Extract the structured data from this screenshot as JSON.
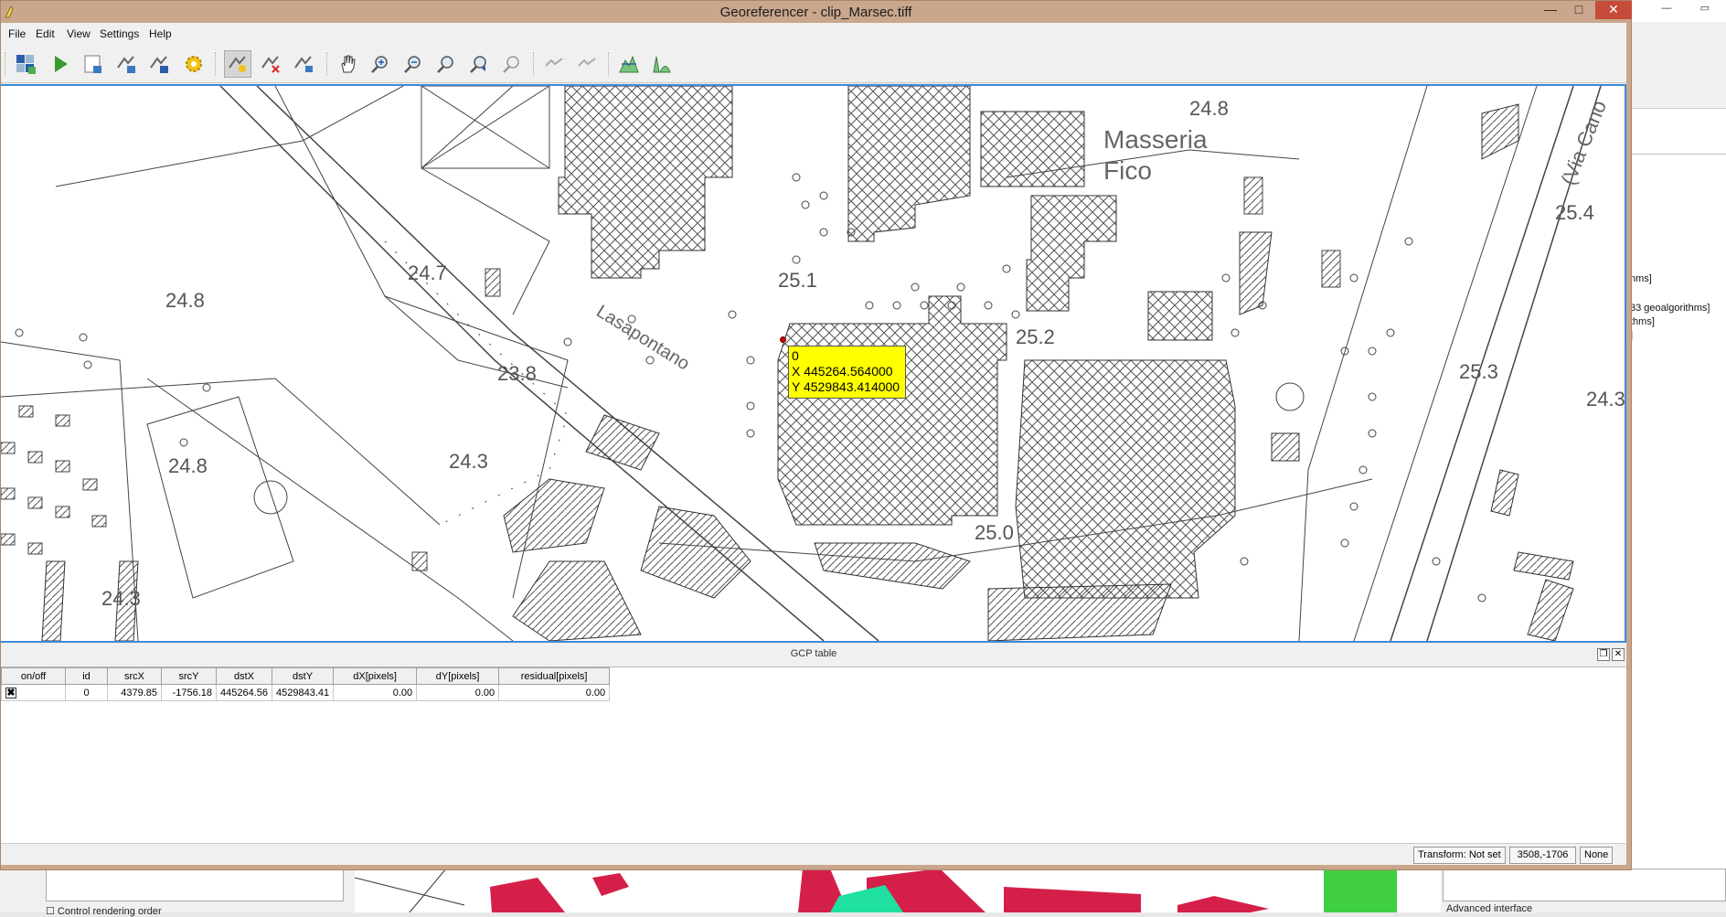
{
  "window": {
    "title": "Georeferencer - clip_Marsec.tiff",
    "controls": {
      "minimize": "—",
      "maximize": "□",
      "close": "✕"
    }
  },
  "menu": [
    "File",
    "Edit",
    "View",
    "Settings",
    "Help"
  ],
  "toolbar": {
    "buttons": [
      "open-raster-icon",
      "start-georeferencing-icon",
      "generate-gdal-script-icon",
      "load-gcp-points-icon",
      "save-gcp-points-icon",
      "transformation-settings-icon",
      "add-point-icon",
      "delete-point-icon",
      "move-gcp-point-icon",
      "pan-icon",
      "zoom-in-icon",
      "zoom-out-icon",
      "zoom-to-layer-icon",
      "zoom-last-icon",
      "zoom-next-icon",
      "link-georeferencer-to-qgis-icon",
      "link-qgis-to-georeferencer-icon",
      "full-histogram-stretch-icon",
      "local-histogram-stretch-icon"
    ]
  },
  "map": {
    "spot_heights": [
      "24.8",
      "25.1",
      "24.7",
      "24.8",
      "23.8",
      "25.2",
      "24.8",
      "24.3",
      "25.0",
      "25.4",
      "25.3",
      "24.3",
      "24.3"
    ],
    "place_labels": [
      "Masseria",
      "Fico",
      "Lasapontano",
      "(Via Cano"
    ],
    "gcp_tooltip": {
      "id": "0",
      "x": "X 445264.564000",
      "y": "Y 4529843.414000"
    }
  },
  "gcp_table": {
    "title": "GCP table",
    "columns": [
      "on/off",
      "id",
      "srcX",
      "srcY",
      "dstX",
      "dstY",
      "dX[pixels]",
      "dY[pixels]",
      "residual[pixels]"
    ],
    "rows": [
      {
        "enabled": "✖",
        "id": "0",
        "srcX": "4379.85",
        "srcY": "-1756.18",
        "dstX": "445264.56",
        "dstY": "4529843.41",
        "dX": "0.00",
        "dY": "0.00",
        "residual": "0.00"
      }
    ]
  },
  "status": {
    "transform": "Transform: Not set",
    "coords": "3508,-1706",
    "crs": "None"
  },
  "background": {
    "tree_lines": [
      "nms]",
      "33 geoalgorithms]",
      "thms]",
      "]"
    ],
    "control_rendering_order": "Control rendering order",
    "advanced_interface": "Advanced interface"
  },
  "colors": {
    "titlebar": "#c9a68c",
    "close_button": "#c74b39",
    "canvas_border": "#3d8ad6",
    "tooltip": "#ffff00",
    "gcp_point": "#cc0000"
  }
}
